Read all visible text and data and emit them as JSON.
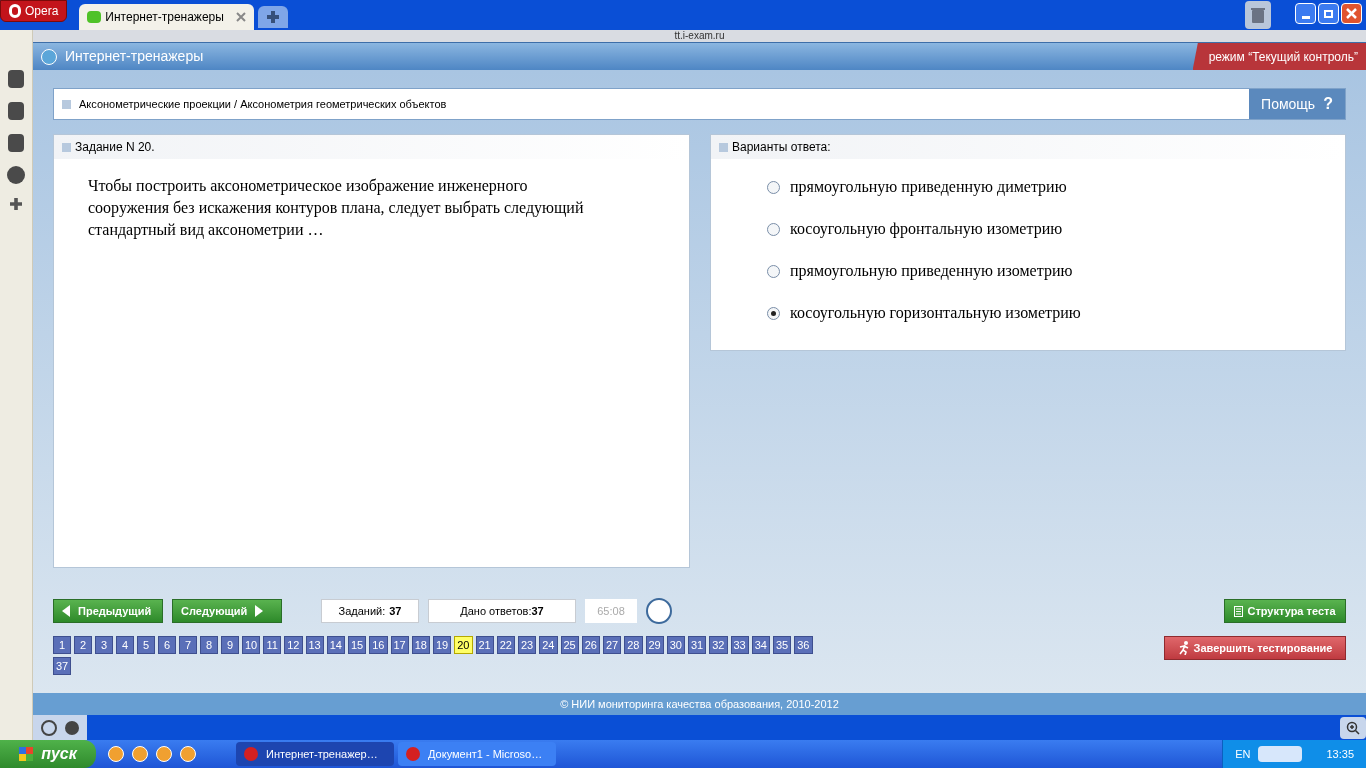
{
  "browser": {
    "menu_button": "Opera",
    "tabs": [
      {
        "label": "Интернет-тренажеры",
        "selected": true
      }
    ],
    "address": "tt.i-exam.ru"
  },
  "header": {
    "title": "Интернет-тренажеры",
    "mode": "режим “Текущий контроль”"
  },
  "breadcrumb": "Аксонометрические проекции / Аксонометрия геометрических объектов",
  "help_button": "Помощь",
  "help_mark": "?",
  "task": {
    "title": "Задание N 20.",
    "text": "Чтобы построить аксонометрическое изображение инженерного сооружения без искажения контуров плана, следует выбрать следующий стандартный вид аксонометрии …"
  },
  "answers": {
    "title": "Варианты ответа:",
    "options": [
      {
        "label": "прямоугольную приведенную диметрию",
        "selected": false
      },
      {
        "label": "косоугольную фронтальную изометрию",
        "selected": false
      },
      {
        "label": "прямоугольную приведенную изометрию",
        "selected": false
      },
      {
        "label": "косоугольную горизонтальную изометрию",
        "selected": true
      }
    ]
  },
  "nav": {
    "prev": "Предыдущий",
    "next": "Следующий",
    "tasks_label": "Заданий:",
    "tasks_count": "37",
    "answered_label": "Дано ответов:",
    "answered_count": "37",
    "timer": "65:08",
    "structure": "Структура теста",
    "finish": "Завершить тестирование"
  },
  "questions": [
    {
      "label": "1",
      "selected": false
    },
    {
      "label": "2",
      "selected": false
    },
    {
      "label": "3",
      "selected": false
    },
    {
      "label": "4",
      "selected": false
    },
    {
      "label": "5",
      "selected": false
    },
    {
      "label": "6",
      "selected": false
    },
    {
      "label": "7",
      "selected": false
    },
    {
      "label": "8",
      "selected": false
    },
    {
      "label": "9",
      "selected": false
    },
    {
      "label": "10",
      "selected": false
    },
    {
      "label": "11",
      "selected": false
    },
    {
      "label": "12",
      "selected": false
    },
    {
      "label": "13",
      "selected": false
    },
    {
      "label": "14",
      "selected": false
    },
    {
      "label": "15",
      "selected": false
    },
    {
      "label": "16",
      "selected": false
    },
    {
      "label": "17",
      "selected": false
    },
    {
      "label": "18",
      "selected": false
    },
    {
      "label": "19",
      "selected": false
    },
    {
      "label": "20",
      "selected": true
    },
    {
      "label": "21",
      "selected": false
    },
    {
      "label": "22",
      "selected": false
    },
    {
      "label": "23",
      "selected": false
    },
    {
      "label": "24",
      "selected": false
    },
    {
      "label": "25",
      "selected": false
    },
    {
      "label": "26",
      "selected": false
    },
    {
      "label": "27",
      "selected": false
    },
    {
      "label": "28",
      "selected": false
    },
    {
      "label": "29",
      "selected": false
    },
    {
      "label": "30",
      "selected": false
    },
    {
      "label": "31",
      "selected": false
    },
    {
      "label": "32",
      "selected": false
    },
    {
      "label": "33",
      "selected": false
    },
    {
      "label": "34",
      "selected": false
    },
    {
      "label": "35",
      "selected": false
    },
    {
      "label": "36",
      "selected": false
    },
    {
      "label": "37",
      "selected": false
    }
  ],
  "footer": "© НИИ мониторинга качества образования, 2010-2012",
  "taskbar": {
    "start": "пуск",
    "windows": [
      {
        "label": "Интернет-тренажер…",
        "selected": true
      },
      {
        "label": "Документ1 - Microso…",
        "selected": false
      }
    ],
    "language": "EN",
    "clock": "13:35"
  }
}
